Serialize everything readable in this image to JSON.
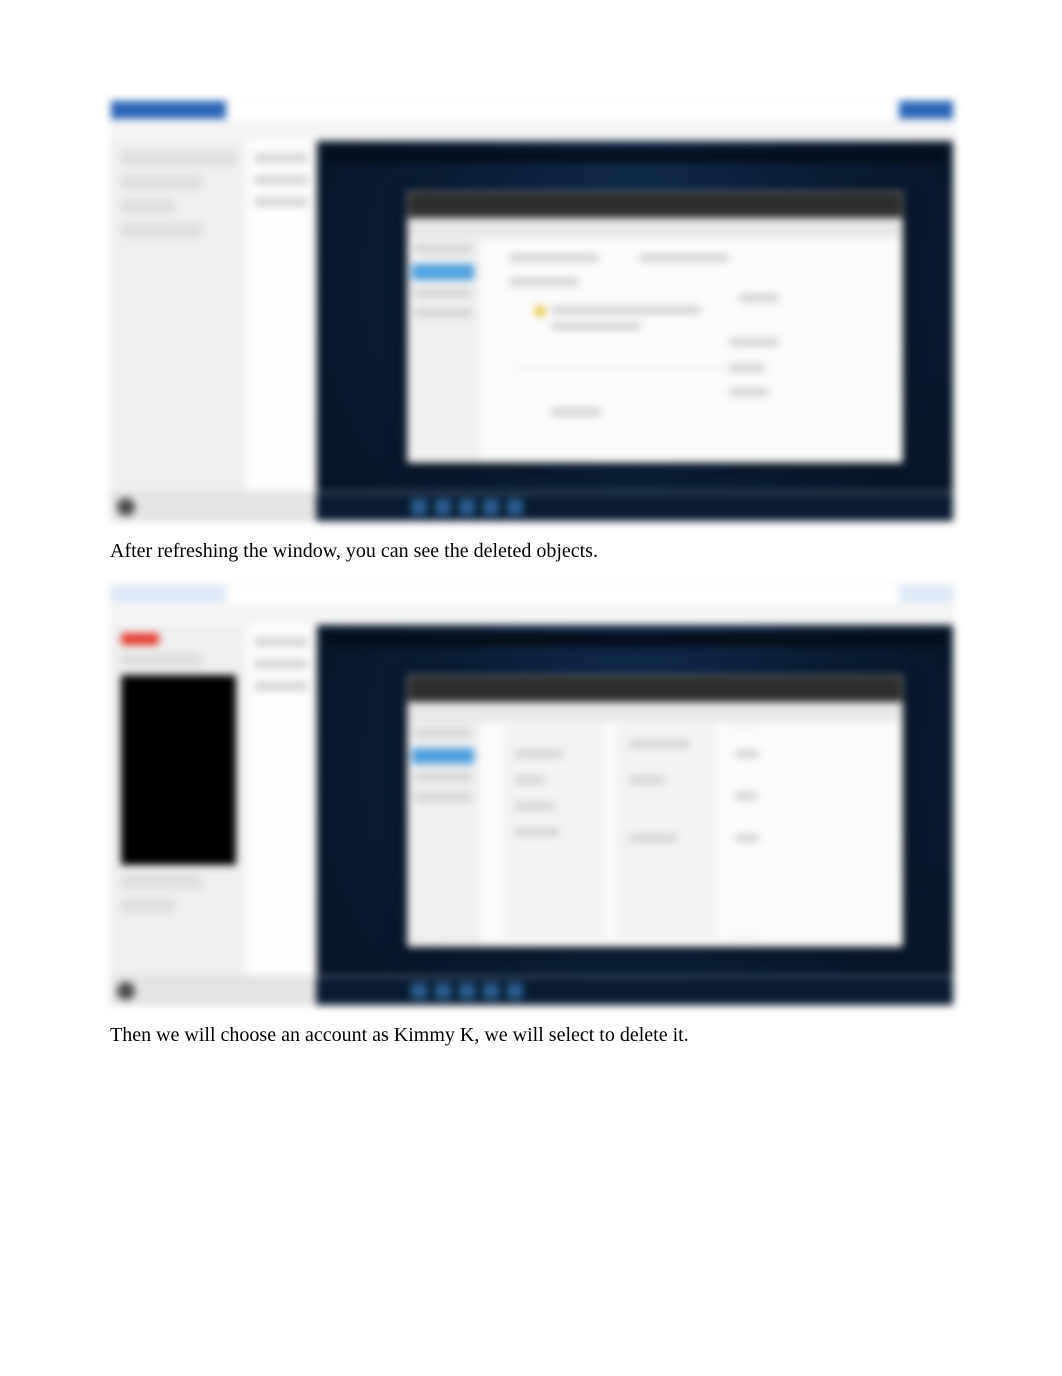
{
  "caption_1": "After refreshing the window, you can see the deleted objects.",
  "caption_2": "Then we will choose an account as Kimmy K, we will select to delete it."
}
